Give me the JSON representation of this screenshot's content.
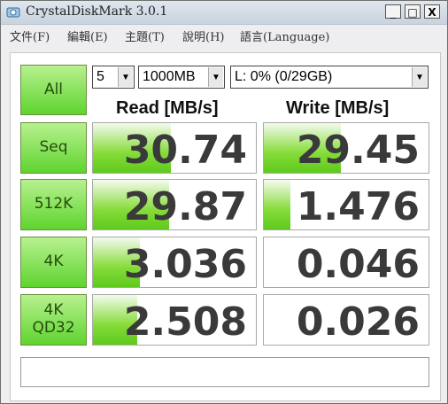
{
  "window": {
    "title": "CrystalDiskMark 3.0.1",
    "min_label": "_",
    "max_label": "□",
    "close_label": "X"
  },
  "menu": [
    "文件(F)",
    "編輯(E)",
    "主題(T)",
    "說明(H)",
    "語言(Language)"
  ],
  "controls": {
    "all_label": "All",
    "count": "5",
    "size": "1000MB",
    "drive": "L: 0% (0/29GB)"
  },
  "headers": {
    "read": "Read [MB/s]",
    "write": "Write [MB/s]"
  },
  "rows": [
    {
      "label": "Seq",
      "read": "30.74",
      "write": "29.45",
      "read_bar": 0.48,
      "write_bar": 0.47
    },
    {
      "label": "512K",
      "read": "29.87",
      "write": "1.476",
      "read_bar": 0.47,
      "write_bar": 0.16
    },
    {
      "label": "4K",
      "read": "3.036",
      "write": "0.046",
      "read_bar": 0.29,
      "write_bar": 0.0
    },
    {
      "label": "4K\nQD32",
      "read": "2.508",
      "write": "0.026",
      "read_bar": 0.27,
      "write_bar": 0.0
    }
  ],
  "colors": {
    "accent_green": "#5ec91c",
    "button_text": "#244d0a"
  },
  "status_text": ""
}
